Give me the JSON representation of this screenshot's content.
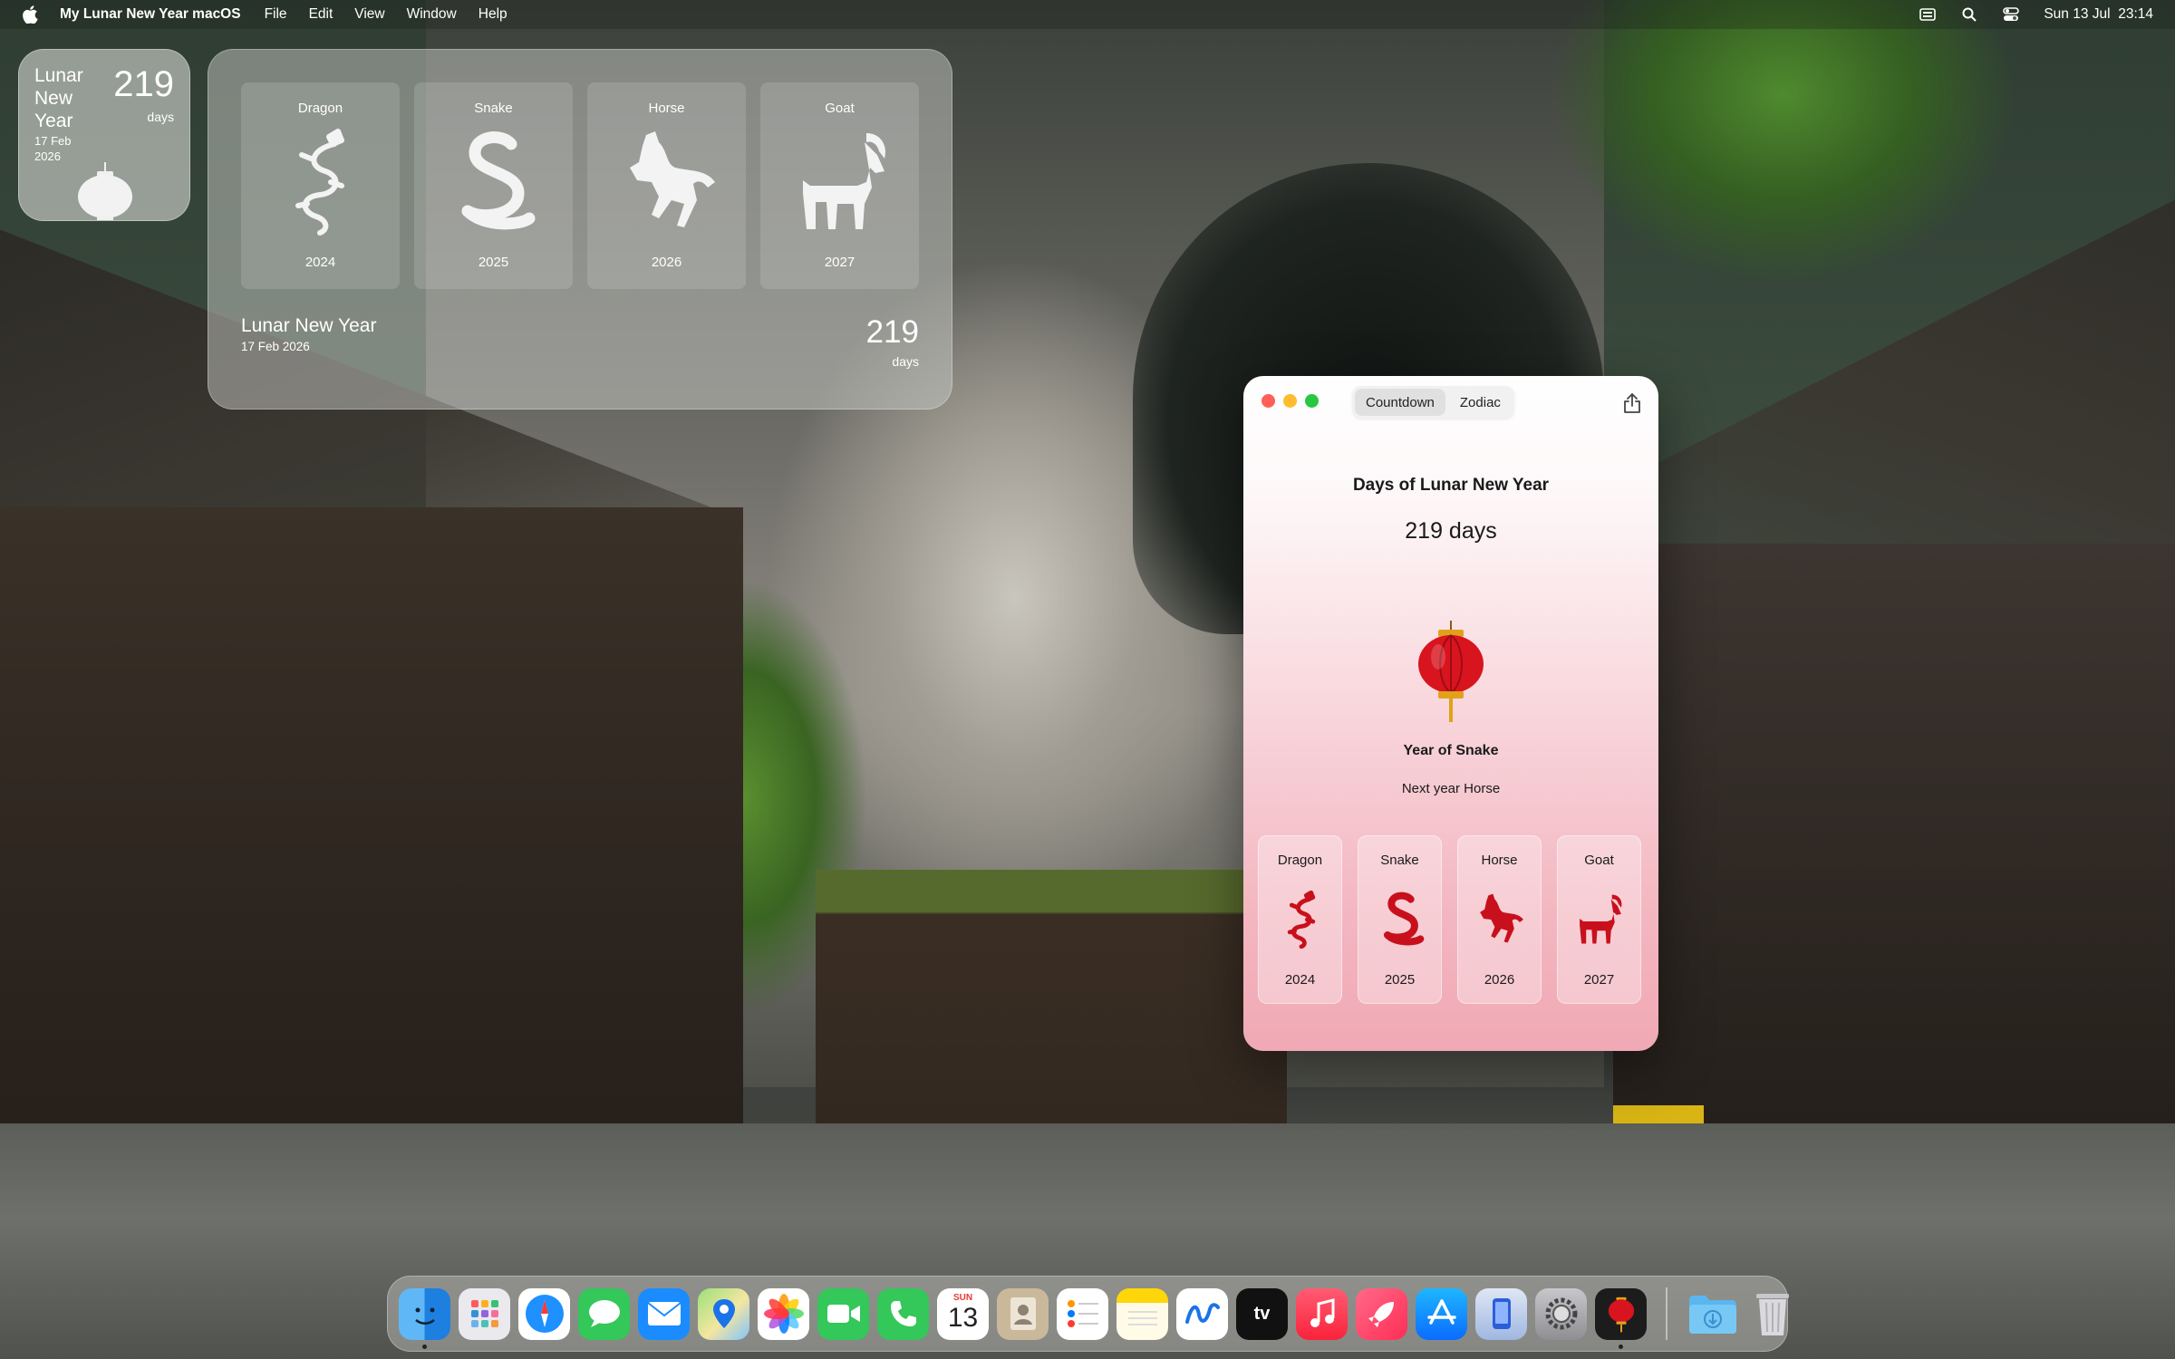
{
  "menubar": {
    "app_name": "My Lunar New Year macOS",
    "menus": [
      "File",
      "Edit",
      "View",
      "Window",
      "Help"
    ],
    "clock": "Sun 13 Jul  23:14"
  },
  "widget_small": {
    "title": "Lunar New Year",
    "date": "17 Feb 2026",
    "count": "219",
    "unit": "days"
  },
  "widget_large": {
    "cards": [
      {
        "name": "Dragon",
        "year": "2024",
        "icon": "dragon-icon"
      },
      {
        "name": "Snake",
        "year": "2025",
        "icon": "snake-icon"
      },
      {
        "name": "Horse",
        "year": "2026",
        "icon": "horse-icon"
      },
      {
        "name": "Goat",
        "year": "2027",
        "icon": "goat-icon"
      }
    ],
    "title": "Lunar New Year",
    "date": "17 Feb 2026",
    "count": "219",
    "unit": "days"
  },
  "app": {
    "tabs": [
      "Countdown",
      "Zodiac"
    ],
    "active_tab": "Countdown",
    "heading": "Days of Lunar New Year",
    "count": "219 days",
    "year_label": "Year of Snake",
    "next_label": "Next year Horse",
    "cards": [
      {
        "name": "Dragon",
        "year": "2024",
        "icon": "dragon-icon"
      },
      {
        "name": "Snake",
        "year": "2025",
        "icon": "snake-icon"
      },
      {
        "name": "Horse",
        "year": "2026",
        "icon": "horse-icon"
      },
      {
        "name": "Goat",
        "year": "2027",
        "icon": "goat-icon"
      }
    ],
    "accent_color": "#d0101e"
  },
  "dock": {
    "calendar": {
      "weekday": "SUN",
      "day": "13"
    },
    "apps": [
      "finder-icon",
      "launchpad-icon",
      "safari-icon",
      "messages-icon",
      "mail-icon",
      "maps-icon",
      "photos-icon",
      "facetime-icon",
      "phone-icon",
      "calendar-icon",
      "contacts-icon",
      "reminders-icon",
      "notes-icon",
      "freeform-icon",
      "appletv-icon",
      "music-icon",
      "rocket-icon",
      "appstore-icon",
      "iphone-mirroring-icon",
      "system-settings-icon",
      "lunar-new-year-app-icon",
      "downloads-folder-icon",
      "trash-icon"
    ],
    "appletv_label": "tv"
  }
}
